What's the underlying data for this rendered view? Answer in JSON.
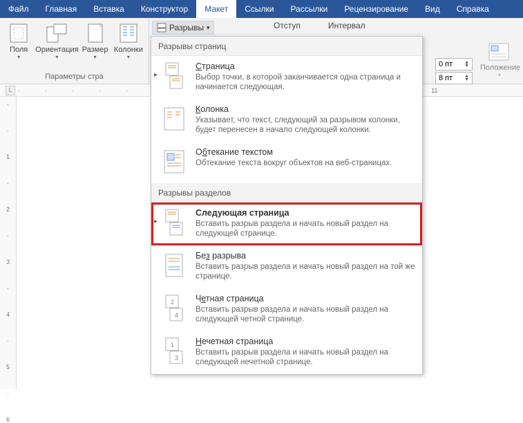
{
  "tabs": {
    "file": "Файл",
    "home": "Главная",
    "insert": "Вставка",
    "design": "Конструктор",
    "layout": "Макет",
    "references": "Ссылки",
    "mailings": "Рассылки",
    "review": "Рецензирование",
    "view": "Вид",
    "help": "Справка"
  },
  "ribbon": {
    "fields": "Поля",
    "orientation": "Ориентация",
    "size": "Размер",
    "columns": "Колонки",
    "group_page_setup": "Параметры стра",
    "breaks": "Разрывы",
    "indent": "Отступ",
    "interval": "Интервал",
    "spacing_before": "0 пт",
    "spacing_after": "8 пт",
    "position": "Положение"
  },
  "dropdown": {
    "section1": "Разрывы страниц",
    "section2": "Разрывы разделов",
    "items": [
      {
        "title_pre": "",
        "title_u": "С",
        "title_post": "траница",
        "desc": "Выбор точки, в которой заканчивается одна страница и начинается следующая."
      },
      {
        "title_pre": "",
        "title_u": "К",
        "title_post": "олонка",
        "desc": "Указывает, что текст, следующий за разрывом колонки, будет перенесен в начало следующей колонки."
      },
      {
        "title_pre": "О",
        "title_u": "б",
        "title_post": "текание текстом",
        "desc": "Обтекание текста вокруг объектов на веб-страницах."
      },
      {
        "title_pre": "Следующая страни",
        "title_u": "ц",
        "title_post": "а",
        "desc": "Вставить разрыв раздела и начать новый раздел на следующей странице."
      },
      {
        "title_pre": "Бе",
        "title_u": "з",
        "title_post": " разрыва",
        "desc": "Вставить разрыв раздела и начать новый раздел на той же странице."
      },
      {
        "title_pre": "Ч",
        "title_u": "е",
        "title_post": "тная страница",
        "desc": "Вставить разрыв раздела и начать новый раздел на следующей четной странице."
      },
      {
        "title_pre": "",
        "title_u": "Н",
        "title_post": "ечетная страница",
        "desc": "Вставить разрыв раздела и начать новый раздел на следующей нечетной странице."
      }
    ]
  },
  "ruler": {
    "corner": "L"
  }
}
